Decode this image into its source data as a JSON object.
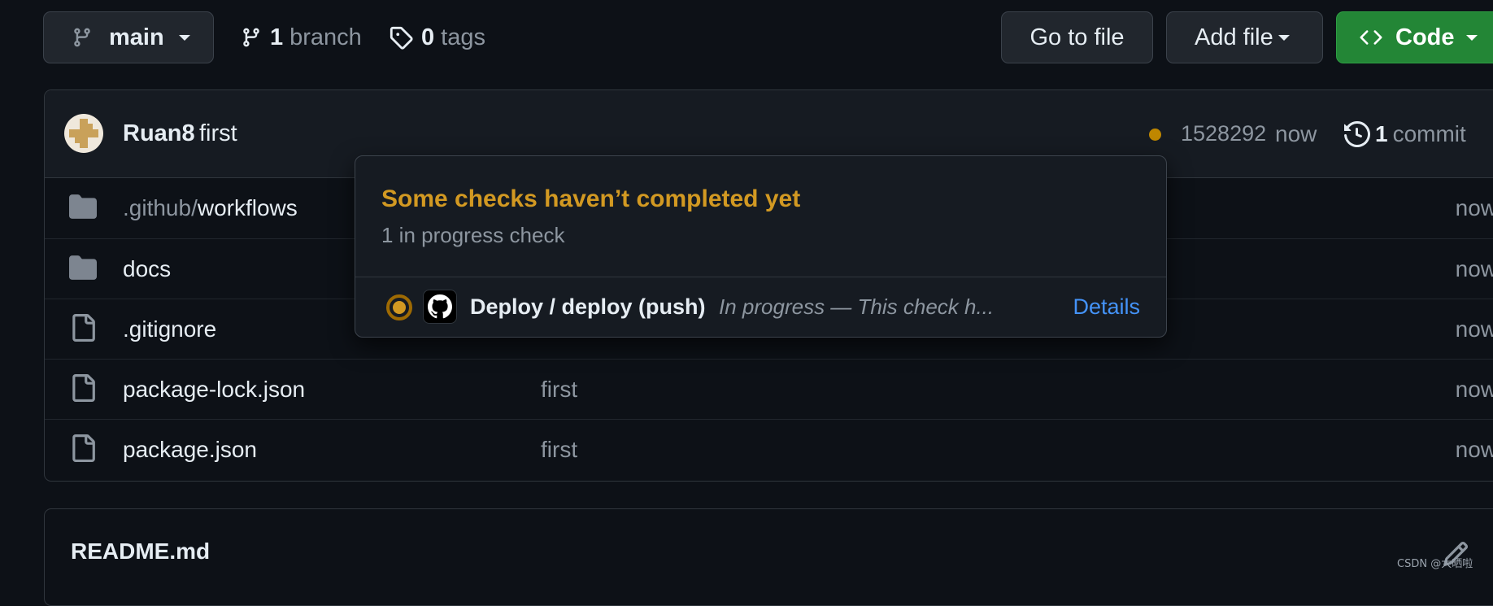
{
  "header": {
    "branch_name": "main",
    "branch_count": "1",
    "branch_label": "branch",
    "tag_count": "0",
    "tag_label": "tags",
    "go_to_file": "Go to file",
    "add_file": "Add file",
    "code": "Code"
  },
  "commit": {
    "author": "Ruan8",
    "message": "first",
    "sha": "1528292",
    "time": "now",
    "commit_count": "1",
    "commit_label": "commit",
    "status_color": "#bf8700"
  },
  "files": [
    {
      "prefix": ".github/",
      "name": "workflows",
      "type": "folder",
      "message": "",
      "age": "now"
    },
    {
      "prefix": "",
      "name": "docs",
      "type": "folder",
      "message": "",
      "age": "now"
    },
    {
      "prefix": "",
      "name": ".gitignore",
      "type": "file",
      "message": "",
      "age": "now"
    },
    {
      "prefix": "",
      "name": "package-lock.json",
      "type": "file",
      "message": "first",
      "age": "now"
    },
    {
      "prefix": "",
      "name": "package.json",
      "type": "file",
      "message": "first",
      "age": "now"
    }
  ],
  "readme": {
    "title": "README.md"
  },
  "popover": {
    "title": "Some checks haven’t completed yet",
    "subtitle": "1 in progress check",
    "check": {
      "name": "Deploy / deploy (push)",
      "status": "In progress — This check h...",
      "details": "Details"
    }
  },
  "watermark": "CSDN @大晒啦",
  "colors": {
    "background": "#0d1117",
    "code_button": "#238636",
    "warning": "#d29922",
    "link": "#4493f8"
  },
  "icons": [
    "git-branch-icon",
    "tag-icon",
    "code-icon",
    "history-icon",
    "folder-icon",
    "file-icon",
    "pencil-icon",
    "github-mark-icon",
    "in-progress-icon"
  ]
}
